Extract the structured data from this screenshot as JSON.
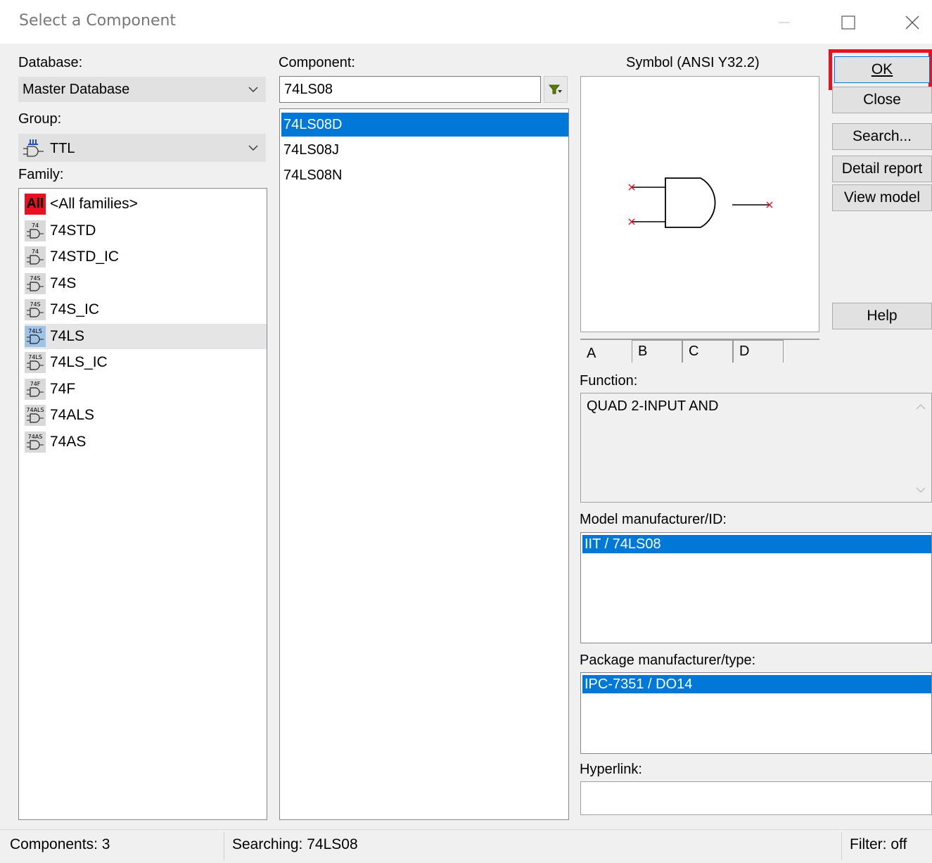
{
  "window": {
    "title": "Select a Component"
  },
  "database": {
    "label": "Database:",
    "value": "Master Database"
  },
  "group": {
    "label": "Group:",
    "value": "TTL"
  },
  "family": {
    "label": "Family:",
    "items": [
      {
        "label": "<All families>",
        "icon": "all-families-icon",
        "badge": "All"
      },
      {
        "label": "74STD",
        "icon": "ttl-gate-icon",
        "badge": "74"
      },
      {
        "label": "74STD_IC",
        "icon": "ttl-gate-icon",
        "badge": "74"
      },
      {
        "label": "74S",
        "icon": "ttl-gate-icon",
        "badge": "74S"
      },
      {
        "label": "74S_IC",
        "icon": "ttl-gate-icon",
        "badge": "74S"
      },
      {
        "label": "74LS",
        "icon": "ttl-gate-icon",
        "badge": "74LS"
      },
      {
        "label": "74LS_IC",
        "icon": "ttl-gate-icon",
        "badge": "74LS"
      },
      {
        "label": "74F",
        "icon": "ttl-gate-icon",
        "badge": "74F"
      },
      {
        "label": "74ALS",
        "icon": "ttl-gate-icon",
        "badge": "74ALS"
      },
      {
        "label": "74AS",
        "icon": "ttl-gate-icon",
        "badge": "74AS"
      }
    ],
    "selected": "74LS"
  },
  "component": {
    "label": "Component:",
    "search_value": "74LS08",
    "items": [
      "74LS08D",
      "74LS08J",
      "74LS08N"
    ],
    "selected": "74LS08D"
  },
  "symbol": {
    "label": "Symbol (ANSI Y32.2)",
    "tabs": [
      "A",
      "B",
      "C",
      "D"
    ],
    "active_tab": "A"
  },
  "function": {
    "label": "Function:",
    "value": "QUAD 2-INPUT AND"
  },
  "model": {
    "label": "Model manufacturer/ID:",
    "value": "IIT / 74LS08"
  },
  "package": {
    "label": "Package manufacturer/type:",
    "value": "IPC-7351 / DO14"
  },
  "hyperlink": {
    "label": "Hyperlink:",
    "value": ""
  },
  "buttons": {
    "ok": "OK",
    "close": "Close",
    "search": "Search...",
    "detail_report": "Detail report",
    "view_model": "View model",
    "help": "Help"
  },
  "status": {
    "components": "Components: 3",
    "searching": "Searching: 74LS08",
    "filter": "Filter: off"
  },
  "colors": {
    "selection": "#0078d7",
    "highlight_box": "#e81123",
    "pin_marker": "#e81123"
  }
}
